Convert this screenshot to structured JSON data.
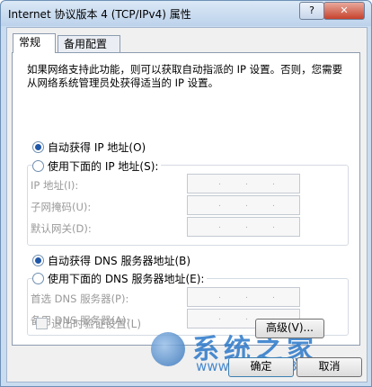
{
  "window": {
    "title": "Internet 协议版本 4 (TCP/IPv4) 属性",
    "help_label": "?",
    "close_label": "✕"
  },
  "tabs": [
    "常规",
    "备用配置"
  ],
  "description": "如果网络支持此功能，则可以获取自动指派的 IP 设置。否则，您需要从网络系统管理员处获得适当的 IP 设置。",
  "ip_section": {
    "auto_label": "自动获得 IP 地址(O)",
    "auto_selected": true,
    "manual_label": "使用下面的 IP 地址(S):",
    "fields": [
      {
        "label": "IP 地址(I):",
        "value": ". . ."
      },
      {
        "label": "子网掩码(U):",
        "value": ". . ."
      },
      {
        "label": "默认网关(D):",
        "value": ". . ."
      }
    ]
  },
  "dns_section": {
    "auto_label": "自动获得 DNS 服务器地址(B)",
    "auto_selected": true,
    "manual_label": "使用下面的 DNS 服务器地址(E):",
    "fields": [
      {
        "label": "首选 DNS 服务器(P):",
        "value": ". . ."
      },
      {
        "label": "备用 DNS 服务器(A):",
        "value": ". . ."
      }
    ]
  },
  "validate_label": "退出时验证设置(L)",
  "buttons": {
    "advanced": "高级(V)...",
    "ok": "确定",
    "cancel": "取消"
  },
  "watermark": {
    "name": "系统之家",
    "url": "www.Ghost123.com"
  }
}
